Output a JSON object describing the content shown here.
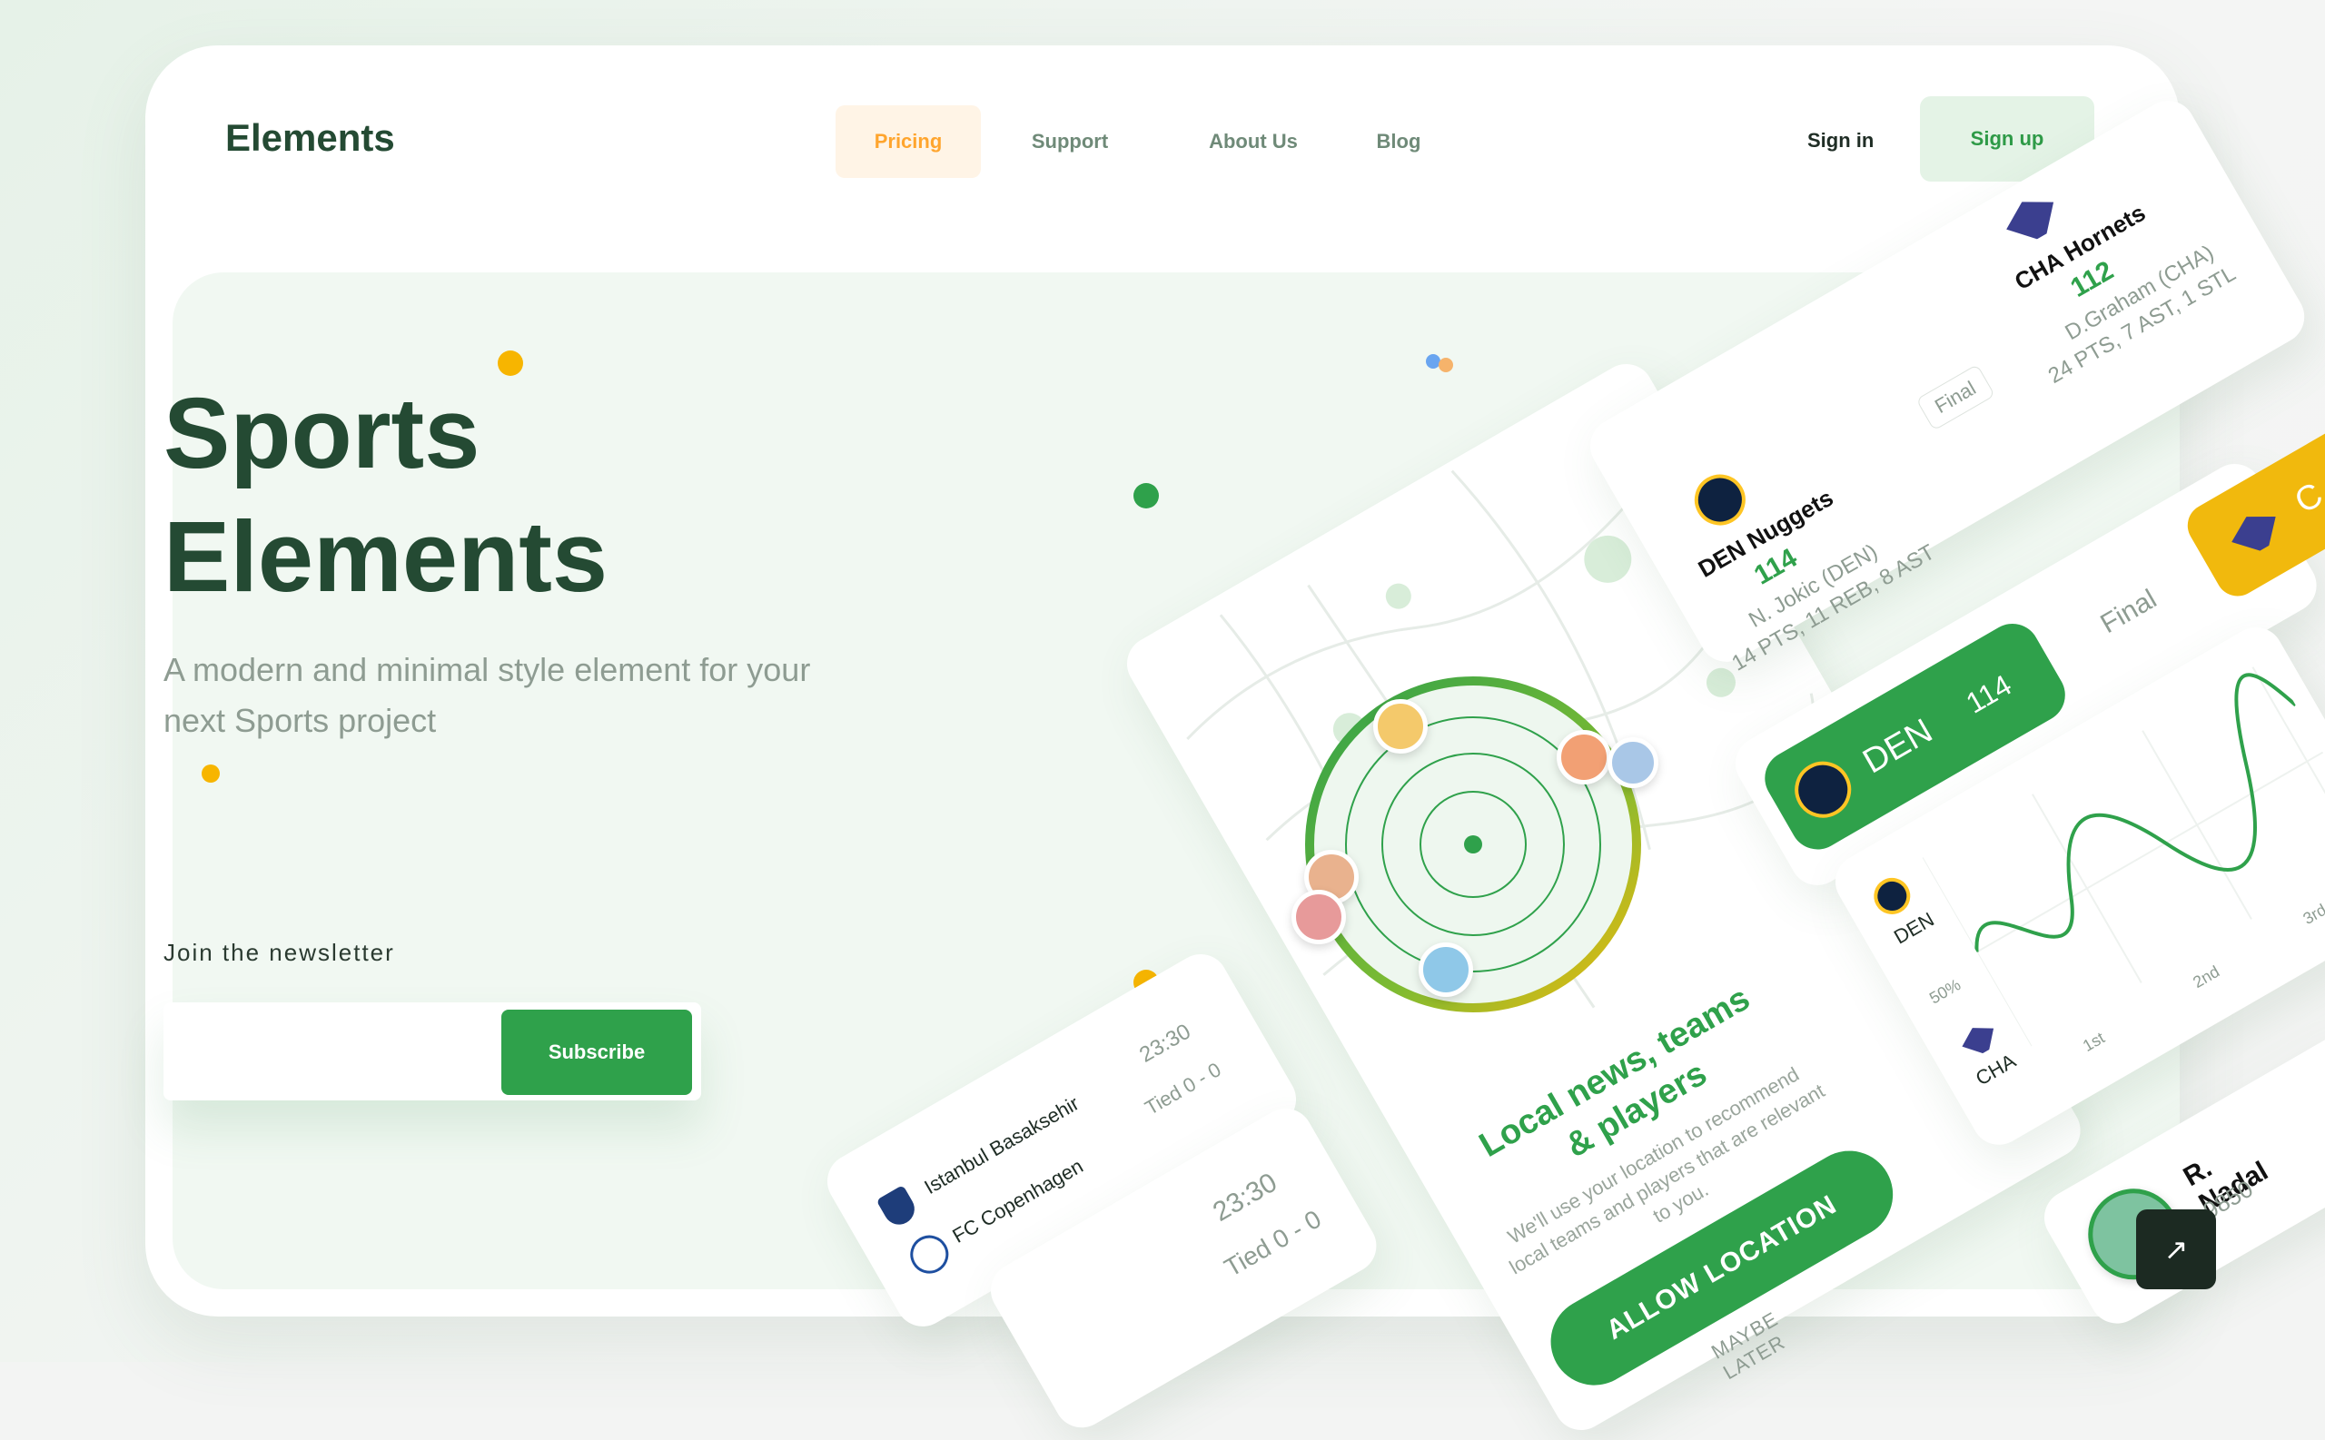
{
  "brand": {
    "name": "Elements"
  },
  "nav": {
    "items": [
      "Pricing",
      "Support",
      "About Us",
      "Blog"
    ],
    "active": "Pricing",
    "sign_in": "Sign in",
    "sign_up": "Sign up"
  },
  "hero": {
    "title_line1": "Sports",
    "title_line2": "Elements",
    "subtitle": "A modern and minimal style element for your next Sports project"
  },
  "newsletter": {
    "label": "Join the newsletter",
    "placeholder": "",
    "button": "Subscribe"
  },
  "game_card": {
    "home": {
      "name": "DEN Nuggets",
      "score": "114",
      "player": "N. Jokic (DEN)",
      "stats": "14 PTS, 11 REB, 8 AST"
    },
    "away": {
      "name": "CHA Hornets",
      "score": "112",
      "player": "D.Graham (CHA)",
      "stats": "24 PTS, 7 AST, 1 STL"
    },
    "status": "Final"
  },
  "score_pill": {
    "team": "DEN",
    "score": "114",
    "status": "Final",
    "next_team_abbr": "C"
  },
  "chart_card": {
    "team_a": "DEN",
    "team_b": "CHA",
    "y_label": "50%",
    "x_labels": [
      "1st",
      "2nd",
      "3rd"
    ]
  },
  "player_card": {
    "name": "R. Nadal",
    "points": "9850"
  },
  "match_cards": [
    {
      "home": "Istanbul Basaksehir",
      "away": "FC Copenhagen",
      "time": "23:30",
      "status": "Tied 0 - 0"
    },
    {
      "time": "23:30",
      "status": "Tied 0 - 0"
    }
  ],
  "location_card": {
    "title": "Local news, teams & players",
    "body": "We'll use your location to recommend local teams and players that are relevant to you.",
    "allow_button": "ALLOW LOCATION",
    "later_link": "MAYBE LATER"
  },
  "colors": {
    "brand_green": "#2fa14b",
    "dark_green": "#244a33",
    "accent_orange": "#ffa52e",
    "yellow": "#f1b90d"
  }
}
